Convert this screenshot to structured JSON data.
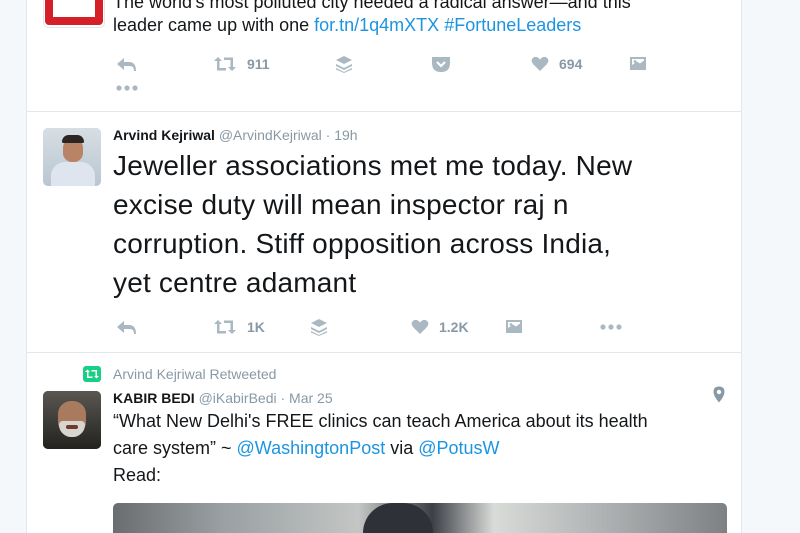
{
  "tweet1": {
    "line1": "The world's most polluted city needed a radical answer—and this",
    "line2_text": "leader came up with one ",
    "link": "for.tn/1q4mXTX",
    "hashtag": "#FortuneLeaders",
    "retweet_count": "911",
    "like_count": "694"
  },
  "tweet2": {
    "name": "Arvind Kejriwal",
    "handle": "@ArvindKejriwal",
    "time": "19h",
    "lines": [
      "Jeweller associations met me today. New",
      "excise duty will mean inspector raj n",
      "corruption. Stiff opposition across India,",
      "yet centre adamant"
    ],
    "retweet_count": "1K",
    "like_count": "1.2K"
  },
  "tweet3": {
    "retweeted_by": "Arvind Kejriwal Retweeted",
    "name": "KABIR BEDI",
    "handle": "@iKabirBedi",
    "date": "Mar 25",
    "line1": "“What New Delhi's FREE clinics can teach America about its health",
    "line2_pre": "care system” ~ ",
    "mention1": "@WashingtonPost",
    "line2_mid": " via ",
    "mention2": "@PotusW",
    "line3": "Read:"
  },
  "icons": [
    "reply-icon",
    "retweet-icon",
    "buffer-icon",
    "pocket-icon",
    "like-icon",
    "media-icon",
    "more-icon",
    "location-pin-icon",
    "retweeted-icon"
  ],
  "colors": {
    "link": "#1b95e0",
    "muted": "#8899a6",
    "icon": "#aab8c2",
    "retweet_green": "#19cf86"
  }
}
